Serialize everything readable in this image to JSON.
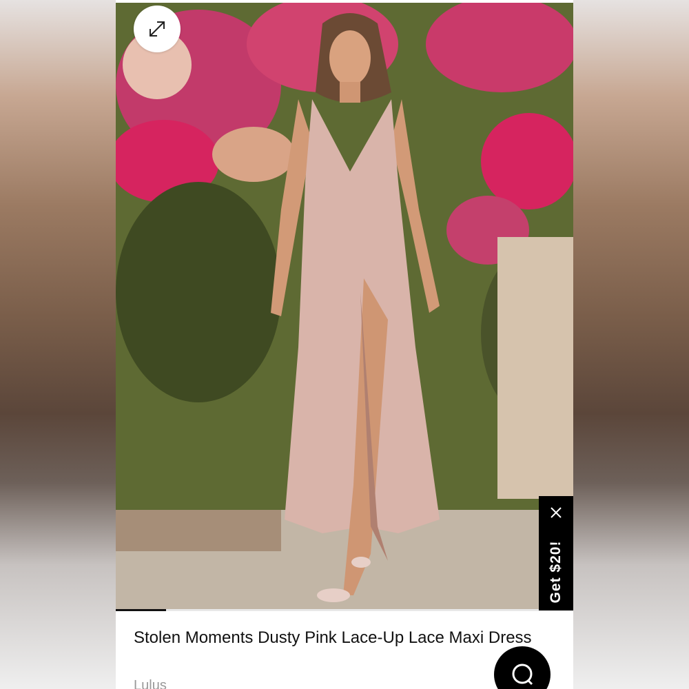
{
  "product": {
    "title": "Stolen Moments Dusty Pink Lace-Up Lace Maxi Dress",
    "brand": "Lulus"
  },
  "gallery": {
    "image_description_icon": "expand-icon",
    "progress": 0.11
  },
  "promo": {
    "label": "Get $20!",
    "close_icon": "close-icon"
  },
  "chat": {
    "icon": "chat-icon"
  },
  "colors": {
    "promo_bg": "#000000",
    "dress": "#d9b4aa",
    "flowers": "#d6245f"
  }
}
